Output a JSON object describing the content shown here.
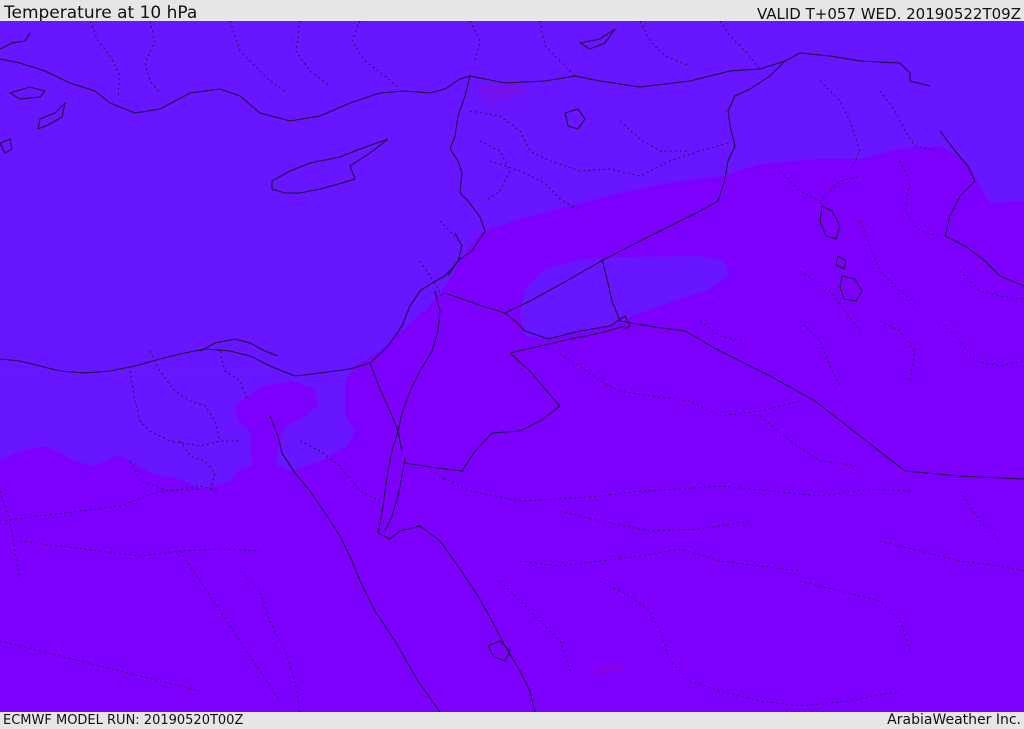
{
  "header": {
    "title": "Temperature at 10 hPa",
    "valid": "VALID T+057 WED. 20190522T09Z"
  },
  "footer": {
    "model_run": "ECMWF MODEL RUN: 20190520T00Z",
    "credit": "ArabiaWeather Inc."
  },
  "map": {
    "colors": {
      "cold_region": "#6716ff",
      "warm_region": "#7d00ff",
      "warm_spot": "#8a00e8",
      "coastline": "#1a1030",
      "border": "#1a1030"
    }
  }
}
